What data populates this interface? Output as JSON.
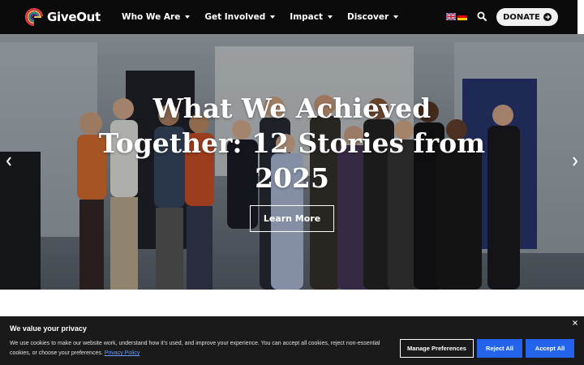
{
  "header": {
    "logo_text": "GiveOut",
    "nav": [
      {
        "label": "Who We Are"
      },
      {
        "label": "Get Involved"
      },
      {
        "label": "Impact"
      },
      {
        "label": "Discover"
      }
    ],
    "donate_label": "DONATE",
    "icons": [
      "uk-flag-icon",
      "germany-flag-icon",
      "search-icon",
      "arrow-circle-right-icon"
    ]
  },
  "hero": {
    "title": "What We Achieved Together: 12 Stories from 2025",
    "cta_label": "Learn More",
    "icons": [
      "chevron-left-icon",
      "chevron-right-icon"
    ]
  },
  "cookie": {
    "title": "We value your privacy",
    "text": "We use cookies to make our website work, understand how it's used, and improve your experience. You can accept all cookies, reject non-essential cookies, or choose your preferences.",
    "link_label": "Privacy Policy",
    "manage_label": "Manage Preferences",
    "reject_label": "Reject All",
    "accept_label": "Accept All"
  },
  "colors": {
    "header_bg": "#0b0b0b",
    "banner_bg": "#1a1a1a",
    "button_blue": "#2463eb",
    "link_blue": "#6b9bff"
  }
}
